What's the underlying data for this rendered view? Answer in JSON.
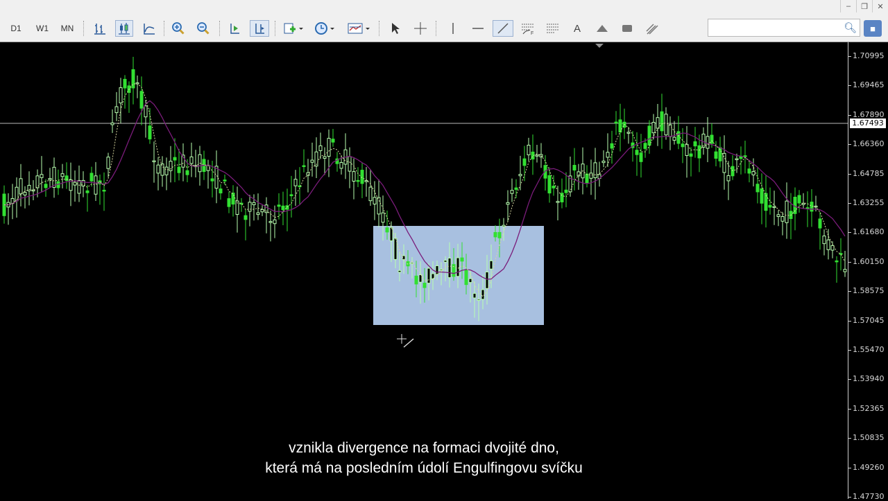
{
  "toolbar": {
    "periods": [
      "D1",
      "W1",
      "MN"
    ],
    "icons": [
      "bar-chart-icon",
      "candlestick-icon",
      "line-chart-icon",
      "zoom-in-icon",
      "zoom-out-icon",
      "autoscroll-icon",
      "chart-shift-icon",
      "indicators-icon",
      "periods-clock-icon",
      "templates-icon",
      "cursor-icon",
      "crosshair-icon",
      "vertical-line-icon",
      "horizontal-line-icon",
      "trendline-icon",
      "fibonacci-icon",
      "channels-icon",
      "text-icon",
      "arrow-shape-icon",
      "rectangle-icon",
      "equidistant-channel-icon"
    ]
  },
  "window_controls": [
    "–",
    "❐",
    "✕"
  ],
  "search": {
    "placeholder": ""
  },
  "chart": {
    "current_price": "1.67493",
    "price_axis": [
      "1.70995",
      "1.69465",
      "1.67890",
      "1.66360",
      "1.64785",
      "1.63255",
      "1.61680",
      "1.60150",
      "1.58575",
      "1.57045",
      "1.55470",
      "1.53940",
      "1.52365",
      "1.50835",
      "1.49260",
      "1.47730"
    ],
    "colors": {
      "bull": "#b9ffb0",
      "bear": "#32e032",
      "ma": "#7a1c7a",
      "highlight": "#a8c0e0",
      "background": "#000000"
    }
  },
  "subtitles": {
    "line1": "vznikla divergence na formaci dvojité dno,",
    "line2": "která má na posledním údolí Engulfingovu svíčku"
  }
}
